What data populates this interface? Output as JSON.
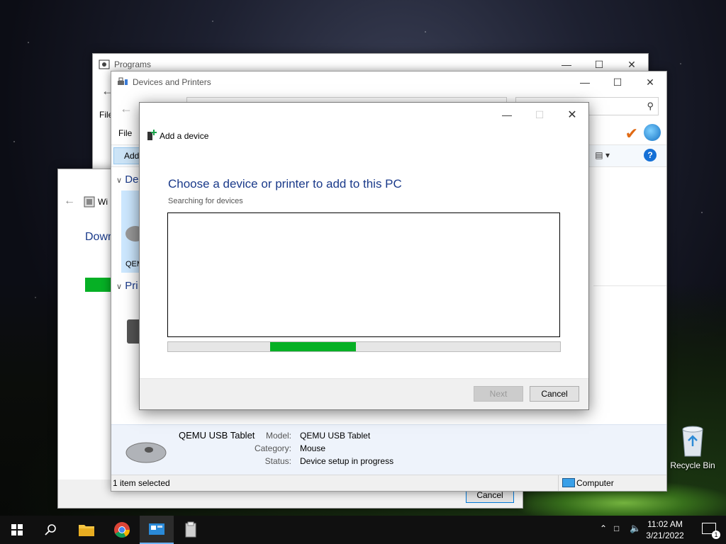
{
  "desktop": {
    "recycle_bin_label": "Recycle Bin"
  },
  "programs_window": {
    "title": "Programs",
    "menu_file": "File"
  },
  "windows_update": {
    "title": "Wi",
    "heading": "Down",
    "cancel_label": "Cancel"
  },
  "devices_printers": {
    "title": "Devices and Printers",
    "menu_file": "File",
    "add_button": "Add",
    "group_devices": "De",
    "group_printers": "Pri",
    "device_short": "QEM",
    "details": {
      "name": "QEMU USB Tablet",
      "model_label": "Model:",
      "model_value": "QEMU USB Tablet",
      "category_label": "Category:",
      "category_value": "Mouse",
      "status_label": "Status:",
      "status_value": "Device setup in progress"
    },
    "status_left": "1 item selected",
    "status_right": "Computer"
  },
  "add_device_dialog": {
    "title": "Add a device",
    "heading": "Choose a device or printer to add to this PC",
    "subheading": "Searching for devices",
    "next_label": "Next",
    "cancel_label": "Cancel",
    "progress": {
      "start_fraction": 0.26,
      "end_fraction": 0.48
    }
  },
  "taskbar": {
    "time": "11:02 AM",
    "date": "3/21/2022",
    "notification_count": "1"
  },
  "colors": {
    "accent": "#1a3a8a",
    "progress": "#06b025"
  }
}
